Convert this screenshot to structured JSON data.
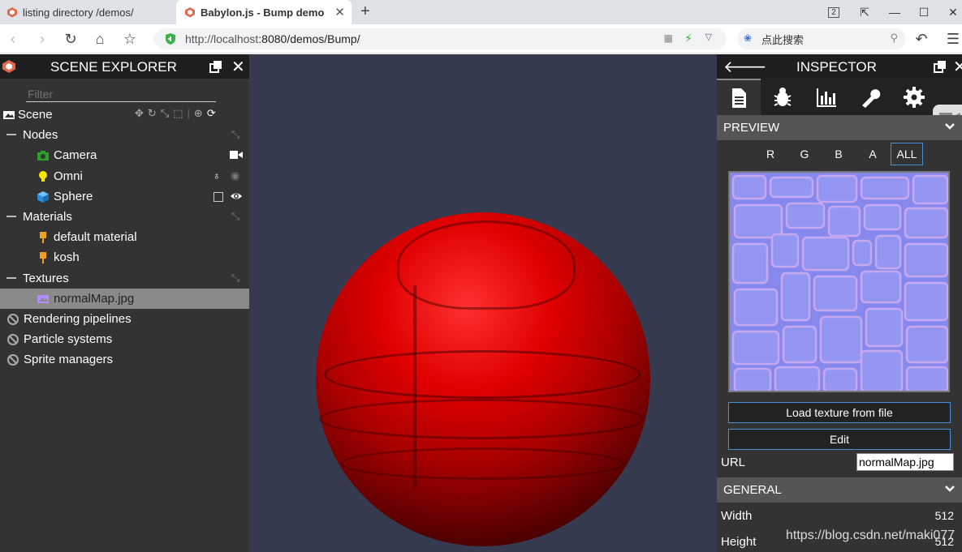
{
  "browser": {
    "tabs": [
      {
        "title": "listing directory /demos/"
      },
      {
        "title": "Babylon.js - Bump demo"
      }
    ],
    "window_badge": "2",
    "url_host": "http://localhost",
    "url_rest": ":8080/demos/Bump/",
    "search_placeholder": "点此搜索"
  },
  "explorer": {
    "title": "SCENE EXPLORER",
    "filter_placeholder": "Filter",
    "scene_label": "Scene",
    "groups": [
      {
        "label": "Nodes",
        "items": [
          "Camera",
          "Omni",
          "Sphere"
        ]
      },
      {
        "label": "Materials",
        "items": [
          "default material",
          "kosh"
        ]
      },
      {
        "label": "Textures",
        "items": [
          "normalMap.jpg"
        ]
      }
    ],
    "extras": [
      "Rendering pipelines",
      "Particle systems",
      "Sprite managers"
    ]
  },
  "inspector": {
    "title": "INSPECTOR",
    "preview_section": "PREVIEW",
    "channels": [
      "R",
      "G",
      "B",
      "A",
      "ALL"
    ],
    "active_channel": "ALL",
    "load_button": "Load texture from file",
    "edit_button": "Edit",
    "url_label": "URL",
    "url_value": "normalMap.jpg",
    "general_section": "GENERAL",
    "width_label": "Width",
    "width_value": "512",
    "height_label": "Height",
    "height_value": "512"
  },
  "watermark": "https://blog.csdn.net/maki077",
  "colors": {
    "panel_bg": "#333333",
    "header_bg": "#1e1e1e",
    "viewport_bg": "#363a4f",
    "sphere_red": "#e00000",
    "selected_row": "#8a8a8a",
    "accent_blue": "#4a90d9"
  }
}
